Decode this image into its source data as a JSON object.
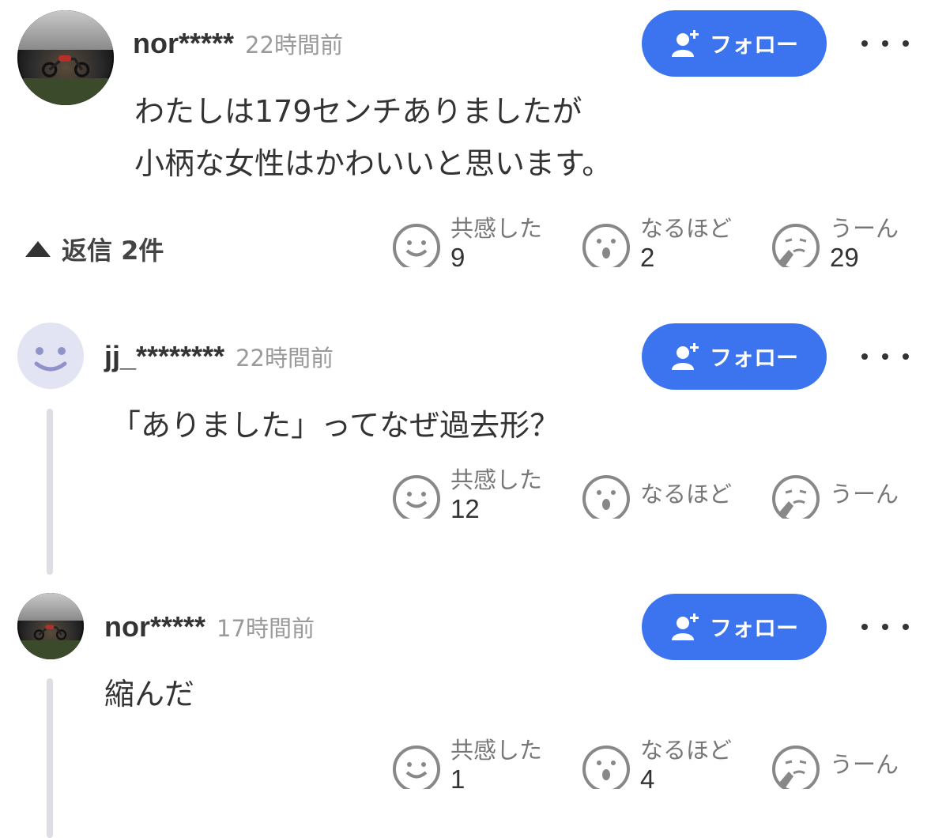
{
  "comment1": {
    "username": "nor*****",
    "time": "22時間前",
    "follow_label": "フォロー",
    "text_line1": "わたしは179センチありましたが",
    "text_line2": "小柄な女性はかわいいと思います。",
    "replies_label": "返信 2件",
    "reactions": {
      "empathy": {
        "label": "共感した",
        "count": "9"
      },
      "naruhodo": {
        "label": "なるほど",
        "count": "2"
      },
      "uun": {
        "label": "うーん",
        "count": "29"
      }
    }
  },
  "reply1": {
    "username": "jj_********",
    "time": "22時間前",
    "follow_label": "フォロー",
    "text": "「ありました」ってなぜ過去形？",
    "reactions": {
      "empathy": {
        "label": "共感した",
        "count": "12"
      },
      "naruhodo": {
        "label": "なるほど",
        "count": ""
      },
      "uun": {
        "label": "うーん",
        "count": ""
      }
    }
  },
  "reply2": {
    "username": "nor*****",
    "time": "17時間前",
    "follow_label": "フォロー",
    "text": "縮んだ",
    "reactions": {
      "empathy": {
        "label": "共感した",
        "count": "1"
      },
      "naruhodo": {
        "label": "なるほど",
        "count": "4"
      },
      "uun": {
        "label": "うーん",
        "count": ""
      }
    }
  },
  "colors": {
    "accent": "#3b74ee",
    "thread_line": "#dddde6",
    "muted": "#9a9a9a"
  },
  "icons": [
    "user-plus-icon",
    "more-icon",
    "smile-icon",
    "surprised-icon",
    "thinking-icon",
    "triangle-up-icon"
  ]
}
